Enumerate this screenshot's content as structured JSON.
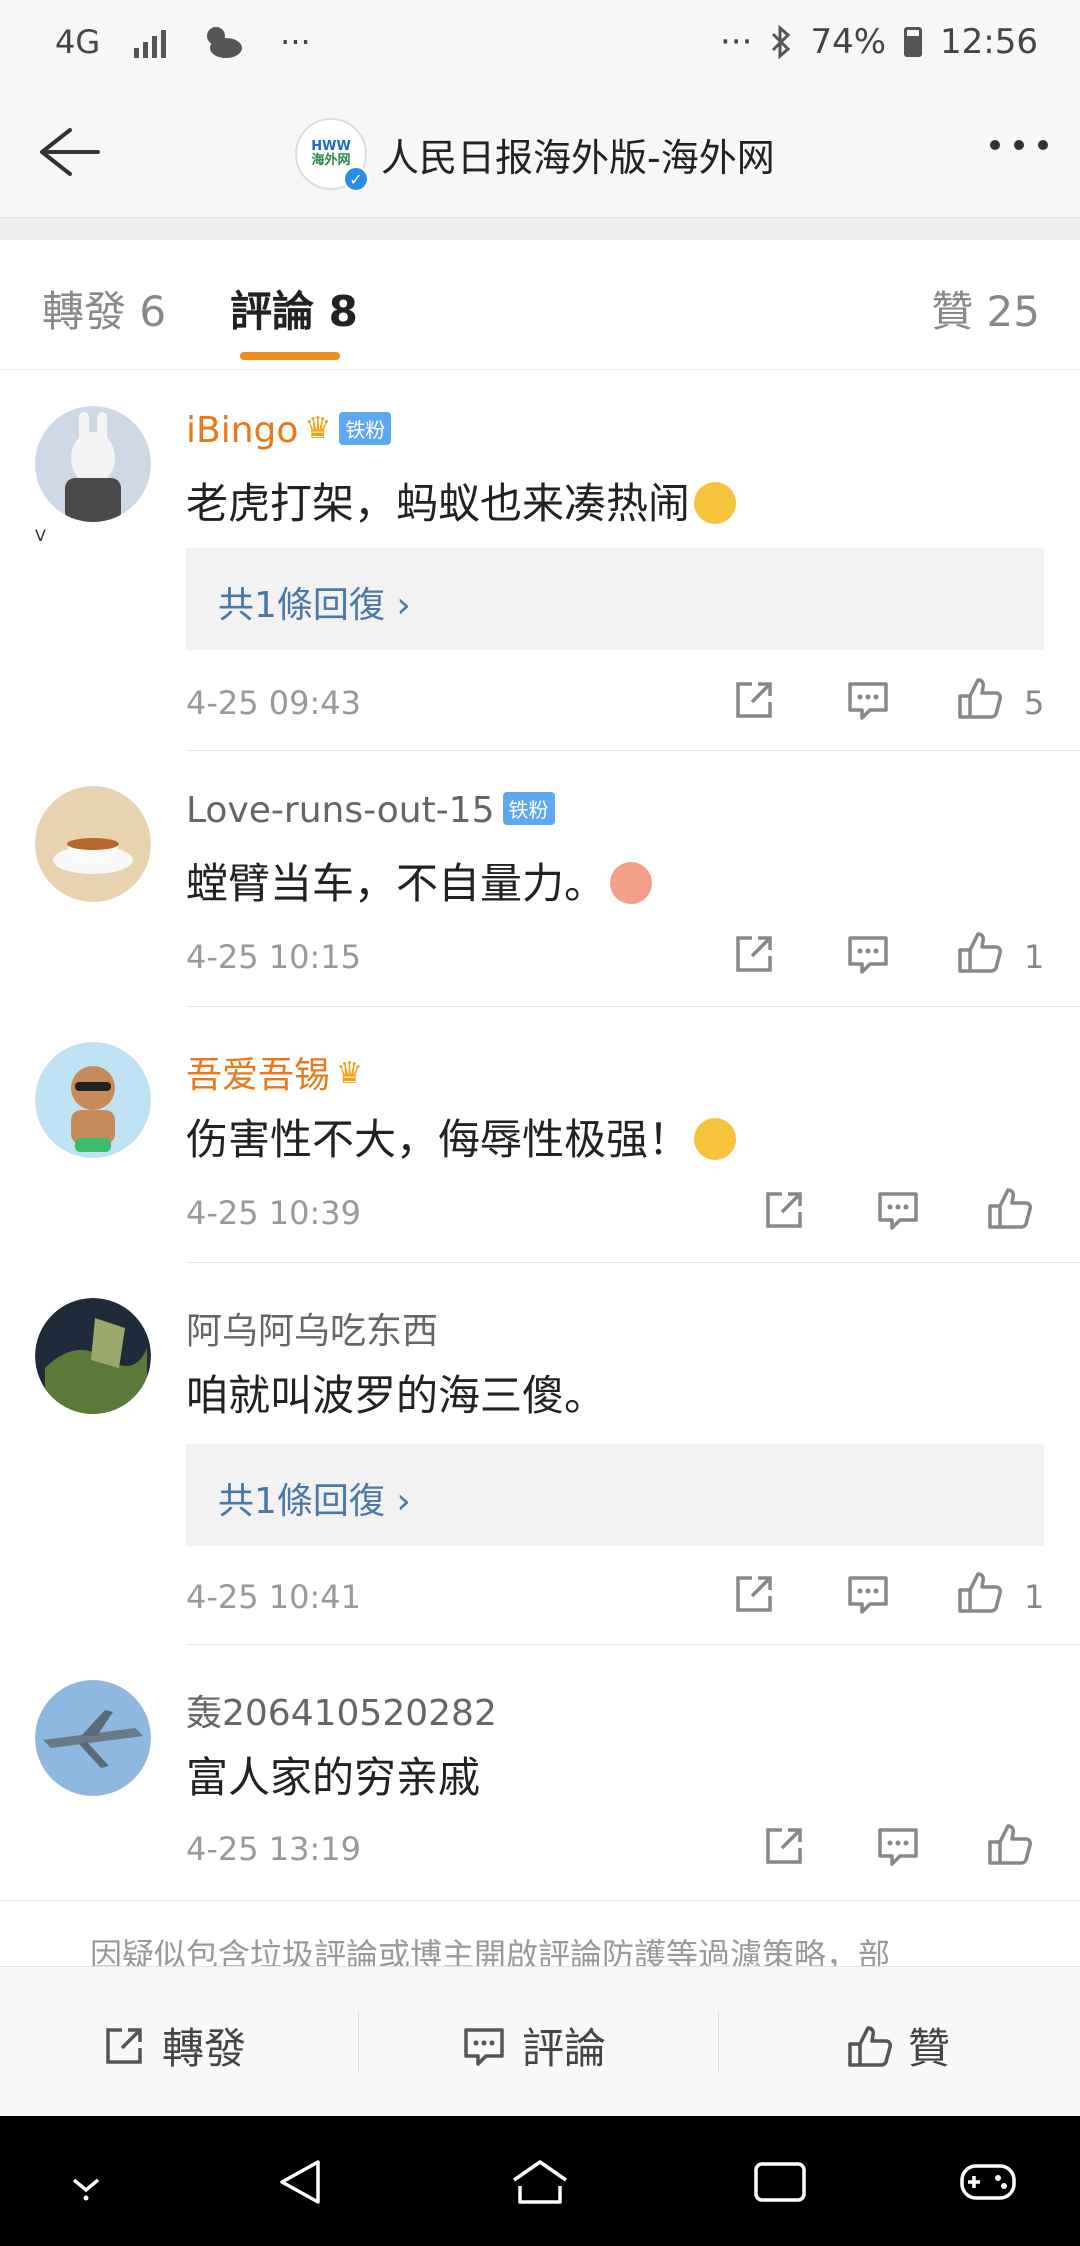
{
  "status_bar": {
    "network": "4G",
    "dots": "···",
    "battery": "74%",
    "time": "12:56"
  },
  "header": {
    "logo_top": "HWW",
    "logo_bottom": "海外网",
    "title": "人民日报海外版-海外网"
  },
  "tabs": [
    {
      "label": "轉發 6"
    },
    {
      "label": "評論 8"
    },
    {
      "label": "贊 25"
    }
  ],
  "comments": [
    {
      "name": "iBingo",
      "badge": "铁粉",
      "text": "老虎打架，蚂蚁也来凑热闹",
      "reply_label": "共1條回復 ›",
      "time": "4-25 09:43",
      "likes": "5"
    },
    {
      "name": "Love-runs-out-15",
      "badge": "铁粉",
      "text": "螳臂当车，不自量力。",
      "time": "4-25 10:15",
      "likes": "1"
    },
    {
      "name": "吾爱吾锡",
      "text": "伤害性不大，侮辱性极强！",
      "time": "4-25 10:39",
      "likes": ""
    },
    {
      "name": "阿乌阿乌吃东西",
      "text": "咱就叫波罗的海三傻。",
      "reply_label": "共1條回復 ›",
      "time": "4-25 10:41",
      "likes": "1"
    },
    {
      "name": "轰206410520282",
      "text": "富人家的穷亲戚",
      "time": "4-25 13:19",
      "likes": ""
    }
  ],
  "notice": "因疑似包含垃圾評論或博主開啟評論防護等過濾策略，部",
  "bottom_bar": {
    "repost": "轉發",
    "comment": "評論",
    "like": "贊"
  },
  "colors": {
    "accent": "#f08c1e",
    "vip_name": "#e8781a",
    "reply_link": "#4a78a8"
  }
}
